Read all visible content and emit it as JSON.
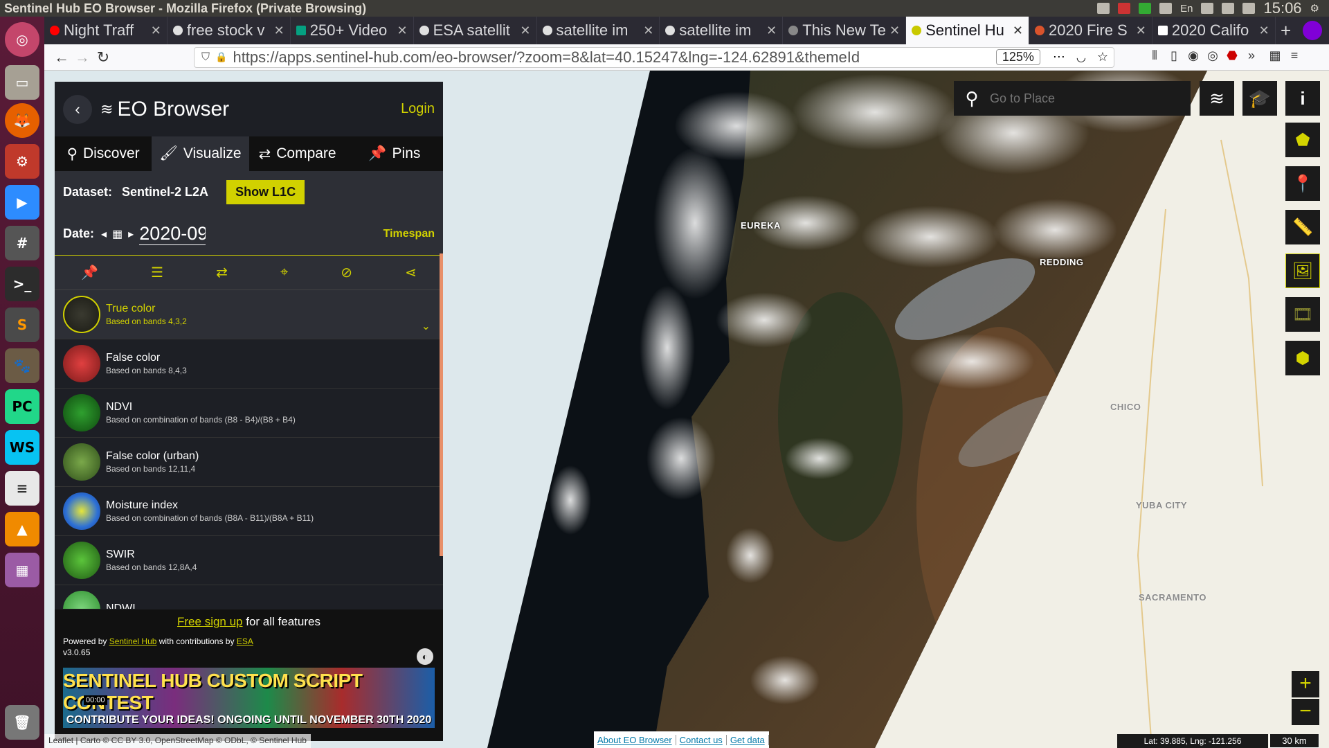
{
  "os": {
    "window_title": "Sentinel Hub EO Browser - Mozilla Firefox (Private Browsing)",
    "keyboard_layout": "En",
    "clock": "15:06"
  },
  "browser": {
    "tabs": [
      {
        "label": "Night Traff",
        "icon": "youtube-icon",
        "active": false
      },
      {
        "label": "free stock v",
        "icon": "google-icon",
        "active": false
      },
      {
        "label": "250+ Video",
        "icon": "pexels-icon",
        "active": false
      },
      {
        "label": "ESA satellit",
        "icon": "google-icon",
        "active": false
      },
      {
        "label": "satellite im",
        "icon": "google-icon",
        "active": false
      },
      {
        "label": "satellite im",
        "icon": "google-icon",
        "active": false
      },
      {
        "label": "This New Te",
        "icon": "site-icon",
        "active": false
      },
      {
        "label": "Sentinel Hu",
        "icon": "sentinel-icon",
        "active": true
      },
      {
        "label": "2020 Fire S",
        "icon": "site-icon",
        "active": false
      },
      {
        "label": "2020 Califo",
        "icon": "wikipedia-icon",
        "active": false
      }
    ],
    "url": "https://apps.sentinel-hub.com/eo-browser/?zoom=8&lat=40.15247&lng=-124.62891&themeId",
    "zoom_level": "125%"
  },
  "app": {
    "title": "EO Browser",
    "login_label": "Login",
    "tabs": [
      {
        "label": "Discover",
        "icon": "search-icon"
      },
      {
        "label": "Visualize",
        "icon": "brush-icon"
      },
      {
        "label": "Compare",
        "icon": "compare-icon"
      },
      {
        "label": "Pins",
        "icon": "pin-icon"
      }
    ],
    "dataset_label": "Dataset:",
    "dataset_value": "Sentinel-2 L2A",
    "show_l1c_label": "Show L1C",
    "date_label": "Date:",
    "date_value": "2020-09",
    "timespan_label": "Timespan",
    "toolbar_icons": [
      "pin-icon",
      "sliders-icon",
      "compare-icon",
      "crosshair-icon",
      "visibility-off-icon",
      "share-icon"
    ],
    "layers": [
      {
        "name": "True color",
        "desc": "Based on bands 4,3,2",
        "active": true,
        "color": "#2a2a22"
      },
      {
        "name": "False color",
        "desc": "Based on bands 8,4,3",
        "active": false,
        "color": "#b82a2a"
      },
      {
        "name": "NDVI",
        "desc": "Based on combination of bands (B8 - B4)/(B8 + B4)",
        "active": false,
        "color": "#1f7a1f"
      },
      {
        "name": "False color (urban)",
        "desc": "Based on bands 12,11,4",
        "active": false,
        "color": "#4f7f2a"
      },
      {
        "name": "Moisture index",
        "desc": "Based on combination of bands (B8A - B11)/(B8A + B11)",
        "active": false,
        "color": "#2c6fd6"
      },
      {
        "name": "SWIR",
        "desc": "Based on bands 12,8A,4",
        "active": false,
        "color": "#3a9a2a"
      },
      {
        "name": "NDWI",
        "desc": "",
        "active": false,
        "color": "#4fbf4f"
      }
    ],
    "footer": {
      "free_signup_link": "Free sign up",
      "free_signup_rest": " for all features",
      "powered_prefix": "Powered by ",
      "powered_link": "Sentinel Hub",
      "powered_mid": " with contributions by ",
      "powered_esa": "ESA",
      "version": "v3.0.65",
      "banner_line1": "SENTINEL HUB CUSTOM SCRIPT CONTEST",
      "banner_line2": "CONTRIBUTE YOUR IDEAS! ONGOING UNTIL NOVEMBER 30TH 2020",
      "banner_time": "00:00"
    }
  },
  "map": {
    "search_placeholder": "Go to Place",
    "cities": [
      {
        "name": "EUREKA",
        "style": "onsat"
      },
      {
        "name": "REDDING",
        "style": "onsat"
      },
      {
        "name": "CHICO",
        "style": "onmap"
      },
      {
        "name": "YUBA CITY",
        "style": "onmap"
      },
      {
        "name": "SACRAMENTO",
        "style": "onmap"
      }
    ],
    "attribution": "Leaflet | Carto © CC BY 3.0, OpenStreetMap © ODbL, © Sentinel Hub",
    "links": [
      "About EO Browser",
      "Contact us",
      "Get data"
    ],
    "coords": "Lat: 39.885, Lng: -121.256",
    "scale": "30 km",
    "zoom_in": "+",
    "zoom_out": "−"
  }
}
